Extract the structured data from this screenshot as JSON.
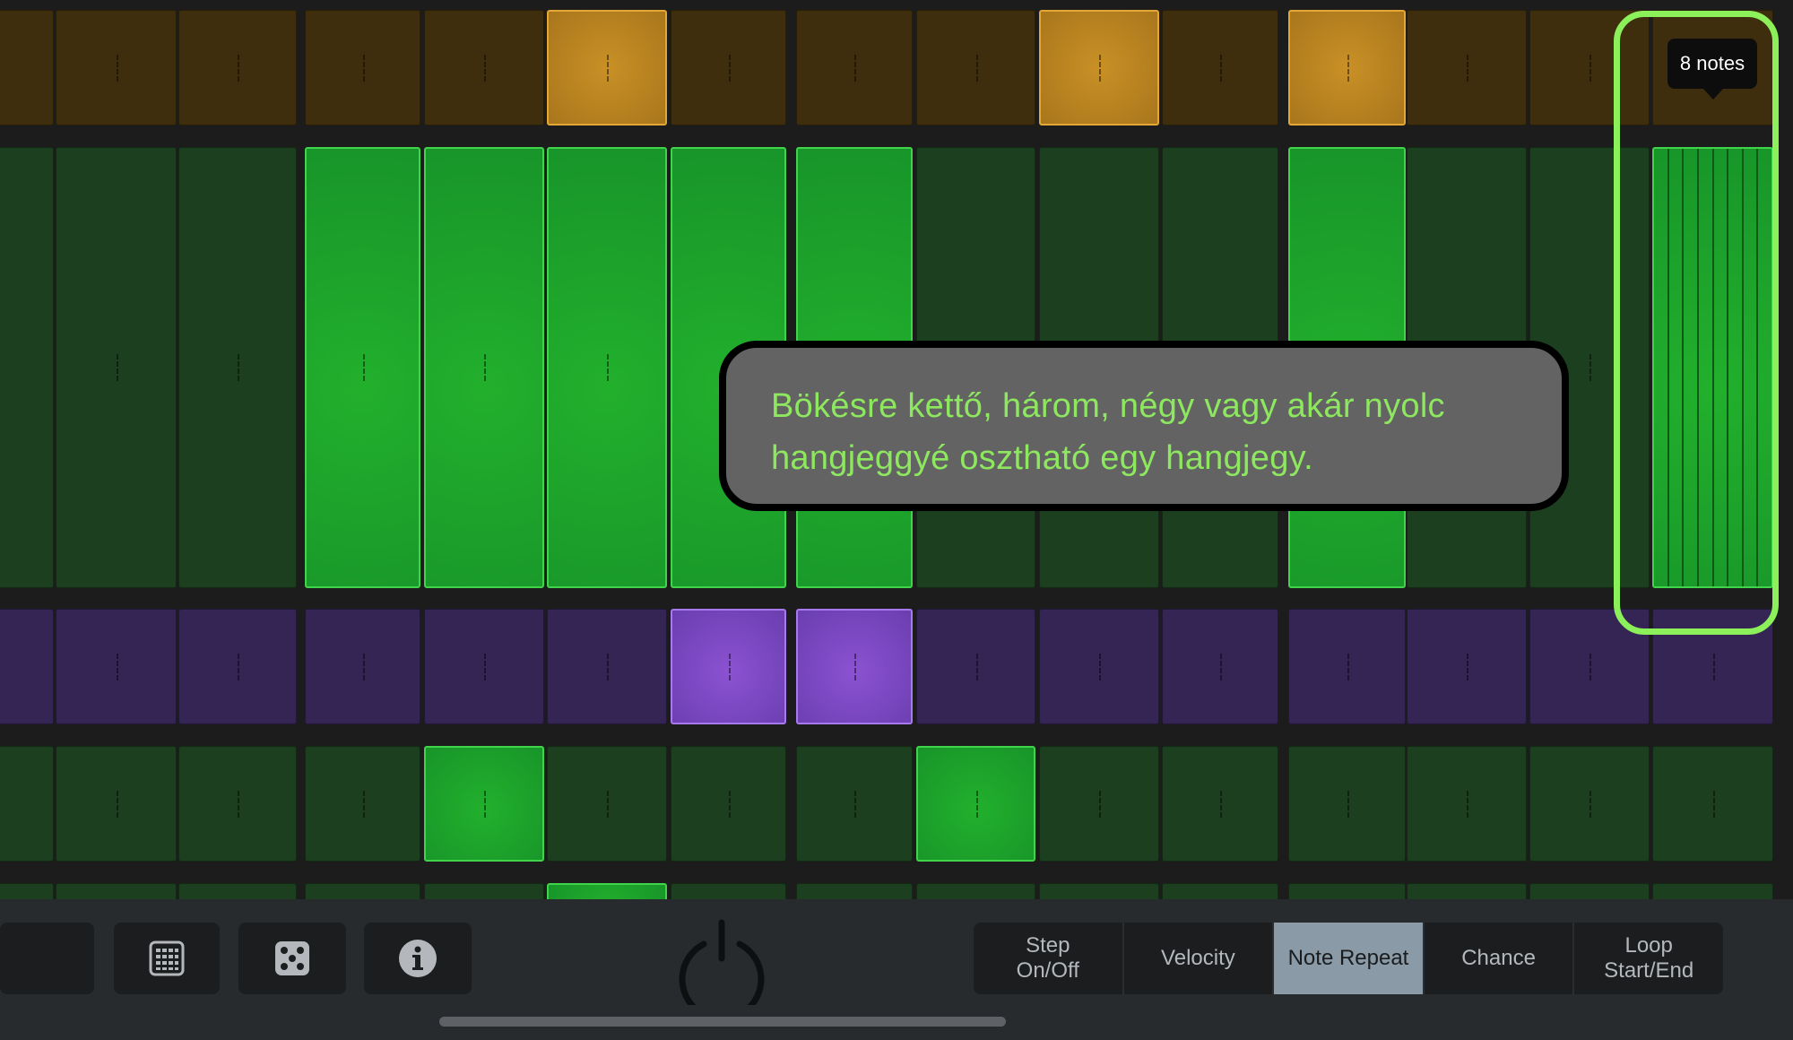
{
  "grid": {
    "rows": [
      {
        "color": "orange",
        "on": [
          5,
          9,
          11
        ]
      },
      {
        "color": "green",
        "on": [
          3,
          4,
          5,
          6,
          7,
          11,
          14
        ],
        "split": {
          "14": 8
        }
      },
      {
        "color": "purple",
        "on": [
          6,
          7
        ]
      },
      {
        "color": "green",
        "on": [
          4,
          8
        ]
      },
      {
        "color": "green",
        "on": [
          5
        ]
      }
    ]
  },
  "highlight": {
    "badge": "8 notes"
  },
  "callout": {
    "text": "Bökésre kettő, három, négy vagy akár nyolc hangjeggyé osztható egy hangjegy."
  },
  "toolbar": {
    "icons": [
      "grid-icon",
      "dice-icon",
      "info-icon",
      "power-icon"
    ],
    "modes": [
      {
        "label": "Step\nOn/Off",
        "active": false
      },
      {
        "label": "Velocity",
        "active": false
      },
      {
        "label": "Note Repeat",
        "active": true
      },
      {
        "label": "Chance",
        "active": false
      },
      {
        "label": "Loop\nStart/End",
        "active": false
      }
    ]
  },
  "colors": {
    "accent": "#8cf05a",
    "active_mode": "#8a9aa6"
  }
}
